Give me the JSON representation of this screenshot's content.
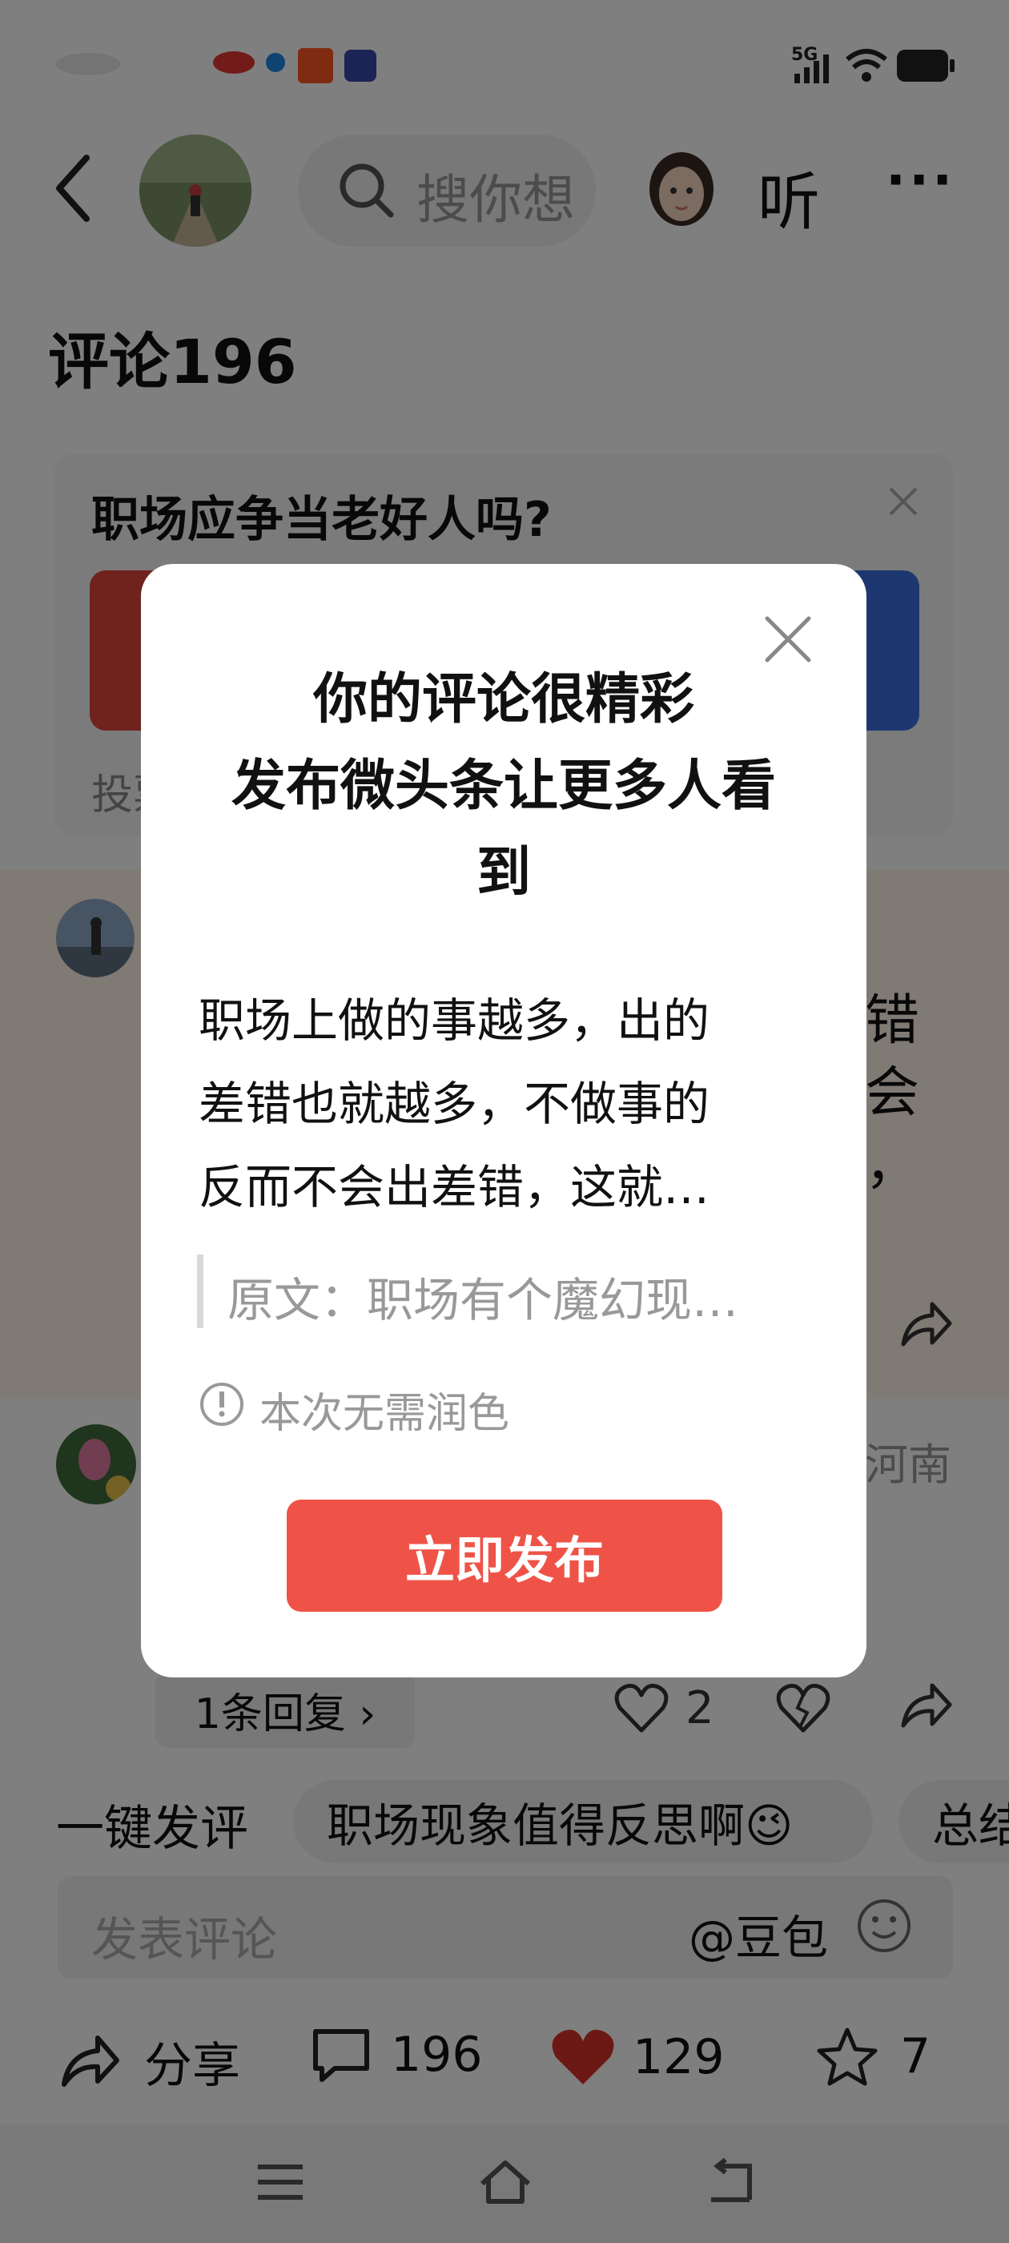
{
  "status_bar": {
    "network": "5G"
  },
  "header": {
    "search_placeholder": "搜你想",
    "listen_label": "听",
    "more_label": "···"
  },
  "comments_title": "评论196",
  "vote": {
    "question": "职场应争当老好人吗?",
    "subtext": "投票"
  },
  "comment1": {
    "text_right": [
      "错",
      "会",
      "，"
    ]
  },
  "comment2": {
    "location": "河南"
  },
  "reply": {
    "replies_label": "1条回复 ›",
    "like_count": "2"
  },
  "quick_comment": {
    "label": "一键发评",
    "chips": [
      "职场现象值得反思啊😉",
      "总结"
    ]
  },
  "comment_input": {
    "placeholder": "发表评论",
    "at_label": "@豆包"
  },
  "bottom_bar": {
    "share_label": "分享",
    "comment_count": "196",
    "like_count": "129",
    "fav_count": "7"
  },
  "modal": {
    "title_line1": "你的评论很精彩",
    "title_line2": "发布微头条让更多人看",
    "title_line3": "到",
    "body_line1": "职场上做的事越多，出的",
    "body_line2": "差错也就越多，不做事的",
    "body_line3": "反而不会出差错，这就…",
    "quote": "原文：职场有个魔幻现…",
    "note": "本次无需润色",
    "publish_button": "立即发布"
  },
  "colors": {
    "accent_red": "#ef5348",
    "vote_blue": "#3b6fe0",
    "like_red": "#d9332b"
  }
}
